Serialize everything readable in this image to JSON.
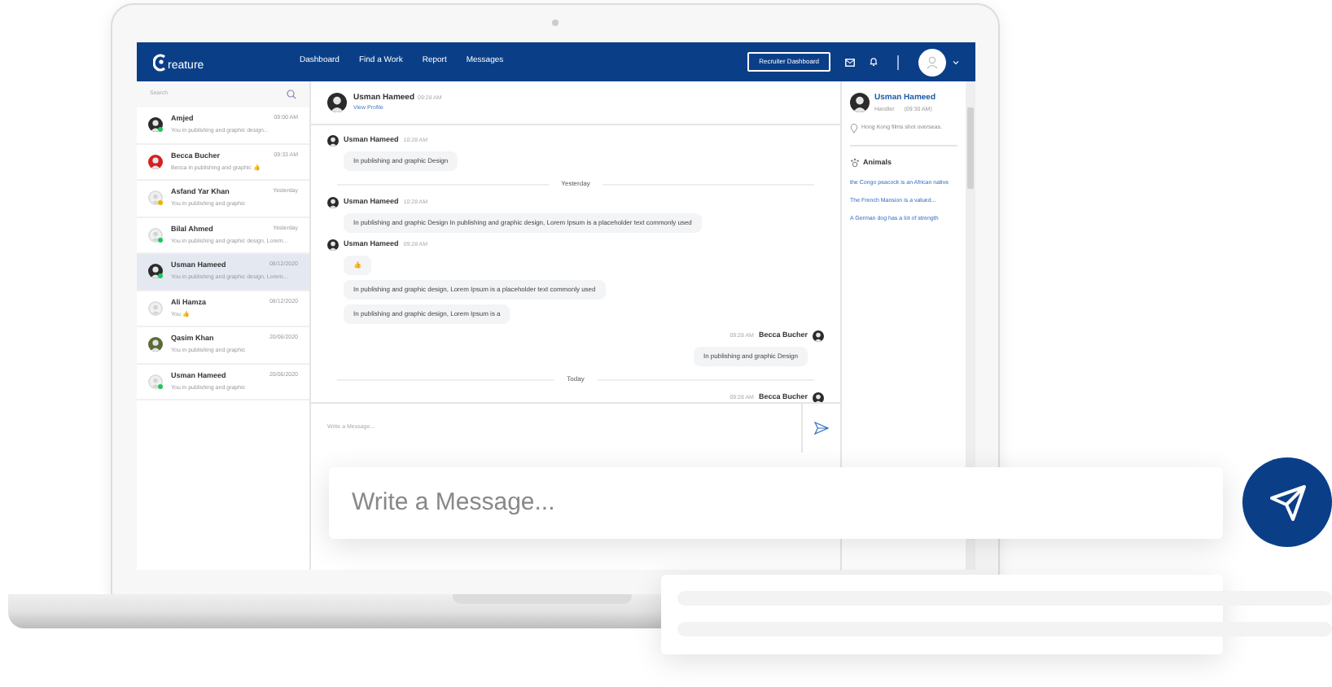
{
  "nav": {
    "logo": "reature",
    "links": [
      "Dashboard",
      "Find a Work",
      "Report",
      "Messages"
    ],
    "button": "Recruiter Dashboard"
  },
  "sidebar": {
    "search_placeholder": "Search",
    "items": [
      {
        "name": "Amjed",
        "time": "09:00 AM",
        "preview": "You in publishing and graphic design...",
        "kind": "photo",
        "color": "#22c55e",
        "selected": false
      },
      {
        "name": "Becca Bucher",
        "time": "09:33 AM",
        "preview": "Becca in publishing and graphic 👍",
        "kind": "photo-red",
        "selected": false
      },
      {
        "name": "Asfand Yar Khan",
        "time": "Yesterday",
        "preview": "You in publishing and graphic",
        "kind": "placeholder",
        "color": "#eab308",
        "selected": false
      },
      {
        "name": "Bilal Ahmed",
        "time": "Yesterday",
        "preview": "You in publishing and graphic design, Lorem...",
        "kind": "placeholder",
        "color": "#22c55e",
        "selected": false
      },
      {
        "name": "Usman Hameed",
        "time": "08/12/2020",
        "preview": "You in publishing and graphic design, Lorem...",
        "kind": "photo",
        "color": "#22c55e",
        "selected": true
      },
      {
        "name": "Ali Hamza",
        "time": "08/12/2020",
        "preview": "You 👍",
        "kind": "placeholder",
        "selected": false
      },
      {
        "name": "Qasim Khan",
        "time": "20/06/2020",
        "preview": "You in publishing and graphic",
        "kind": "photo-green",
        "selected": false
      },
      {
        "name": "Usman Hameed",
        "time": "20/06/2020",
        "preview": "You in publishing and graphic",
        "kind": "placeholder",
        "color": "#22c55e",
        "selected": false
      }
    ]
  },
  "chat": {
    "header": {
      "name": "Usman Hameed",
      "time": "09:28 AM",
      "link": "View Profile"
    },
    "messages": [
      {
        "kind": "incoming",
        "name": "Usman Hameed",
        "time": "10:28 AM",
        "bubbles": [
          "In publishing and graphic Design"
        ]
      },
      {
        "kind": "divider",
        "label": "Yesterday"
      },
      {
        "kind": "incoming",
        "name": "Usman Hameed",
        "time": "10:28 AM",
        "bubbles": [
          "In publishing and graphic Design In publishing and graphic design, Lorem Ipsum is a placeholder text commonly used"
        ]
      },
      {
        "kind": "incoming",
        "name": "Usman Hameed",
        "time": "09:28 AM",
        "bubbles": [
          "👍",
          "In publishing and graphic design, Lorem Ipsum is a placeholder text commonly used",
          "In publishing and graphic design, Lorem Ipsum is a"
        ]
      },
      {
        "kind": "outgoing",
        "name": "Becca Bucher",
        "time": "09:28 AM",
        "bubbles": [
          "In publishing and graphic Design"
        ]
      },
      {
        "kind": "divider",
        "label": "Today"
      },
      {
        "kind": "outgoing",
        "name": "Becca Bucher",
        "time": "09:28 AM"
      }
    ],
    "input_placeholder": "Write a Message..."
  },
  "profile": {
    "name": "Usman Hameed",
    "role": "Handler",
    "time": "(09:30 AM)",
    "location": "Hong Kong films shot overseas.",
    "section": "Animals",
    "links": [
      "the Congo peacock is an African native",
      "The French Mansion is a valued...",
      "A German dog has a lot of strength"
    ]
  },
  "floating": {
    "placeholder": "Write a Message..."
  }
}
